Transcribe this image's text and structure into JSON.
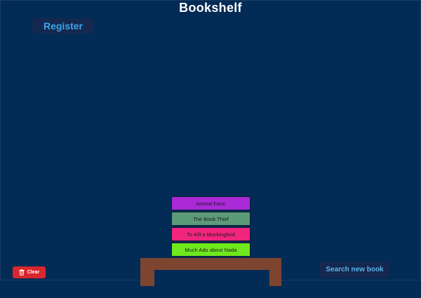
{
  "app": {
    "title": "Bookshelf"
  },
  "header": {
    "register_label": "Register"
  },
  "books": [
    {
      "title": "Animal Farm",
      "color": "#a92ad6"
    },
    {
      "title": "The Book Thief",
      "color": "#5c9b78"
    },
    {
      "title": "To Kill a Mockingbird",
      "color": "#f2257e"
    },
    {
      "title": "Much Ado about Nada",
      "color": "#6fe91e"
    }
  ],
  "shelf": {
    "color": "#7d4530"
  },
  "footer": {
    "clear_label": "Clear",
    "clear_icon": "trash-icon",
    "search_label": "Search new book"
  },
  "theme": {
    "background": "#022b55",
    "button_bg": "#142850",
    "accent": "#3aa7e8",
    "danger": "#d9262c"
  }
}
